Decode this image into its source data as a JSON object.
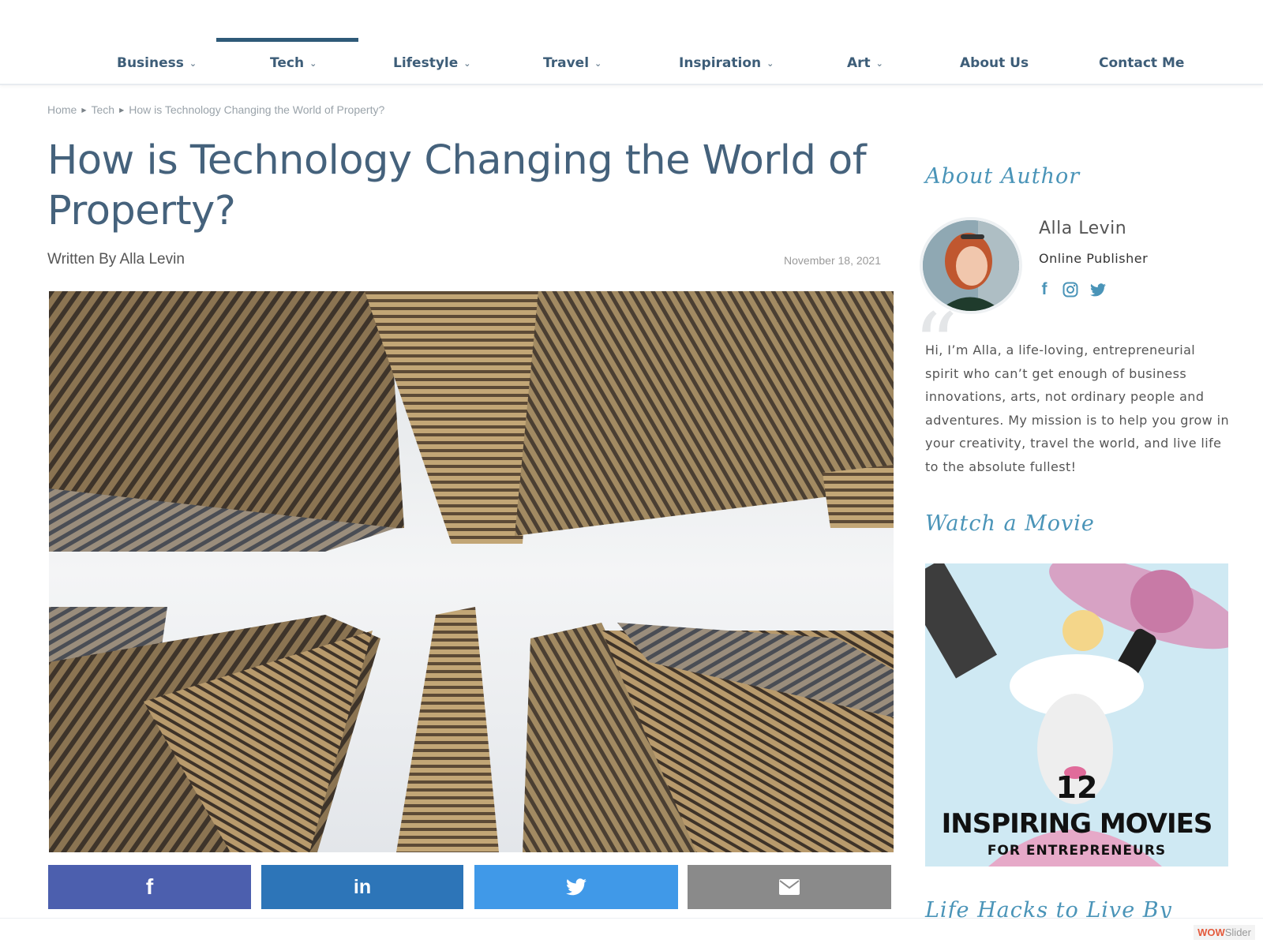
{
  "nav": {
    "items": [
      {
        "label": "Business",
        "dropdown": true
      },
      {
        "label": "Tech",
        "dropdown": true,
        "active": true
      },
      {
        "label": "Lifestyle",
        "dropdown": true
      },
      {
        "label": "Travel",
        "dropdown": true
      },
      {
        "label": "Inspiration",
        "dropdown": true
      },
      {
        "label": "Art",
        "dropdown": true
      },
      {
        "label": "About Us",
        "dropdown": false
      },
      {
        "label": "Contact Me",
        "dropdown": false
      }
    ]
  },
  "breadcrumb": {
    "home": "Home",
    "category": "Tech",
    "current": "How is Technology Changing the World of Property?"
  },
  "post": {
    "title": "How is Technology Changing the World of Property?",
    "byline": "Written By Alla Levin",
    "date": "November 18, 2021",
    "hero_icon": "skyscrapers-photo"
  },
  "share": {
    "facebook": "facebook-icon",
    "linkedin": "linkedin-icon",
    "twitter": "twitter-icon",
    "email": "email-icon"
  },
  "sidebar": {
    "about_title": "About Author",
    "author_name": "Alla Levin",
    "author_role": "Online Publisher",
    "social": [
      "facebook-icon",
      "instagram-icon",
      "twitter-icon"
    ],
    "bio": "Hi, I’m Alla, a life-loving, entrepreneurial spirit who can’t get enough of business innovations, arts, not ordinary people and adventures. My mission is to help you grow in your creativity, travel the world, and live life to the absolute fullest!",
    "movie_title": "Watch a Movie",
    "movie_ad": {
      "number": "12",
      "main": "INSPIRING MOVIES",
      "sub": "FOR    ENTREPRENEURS"
    },
    "next_title": "Life Hacks to Live By"
  },
  "footer": {
    "wowslider_a": "WOW",
    "wowslider_b": "Slider"
  },
  "colors": {
    "nav_text": "#3d5d78",
    "title": "#45627c",
    "widget_title": "#4a94b8",
    "facebook": "#4c5fae",
    "linkedin": "#2d75b8",
    "twitter": "#4099e8",
    "email": "#8a8a8a"
  }
}
